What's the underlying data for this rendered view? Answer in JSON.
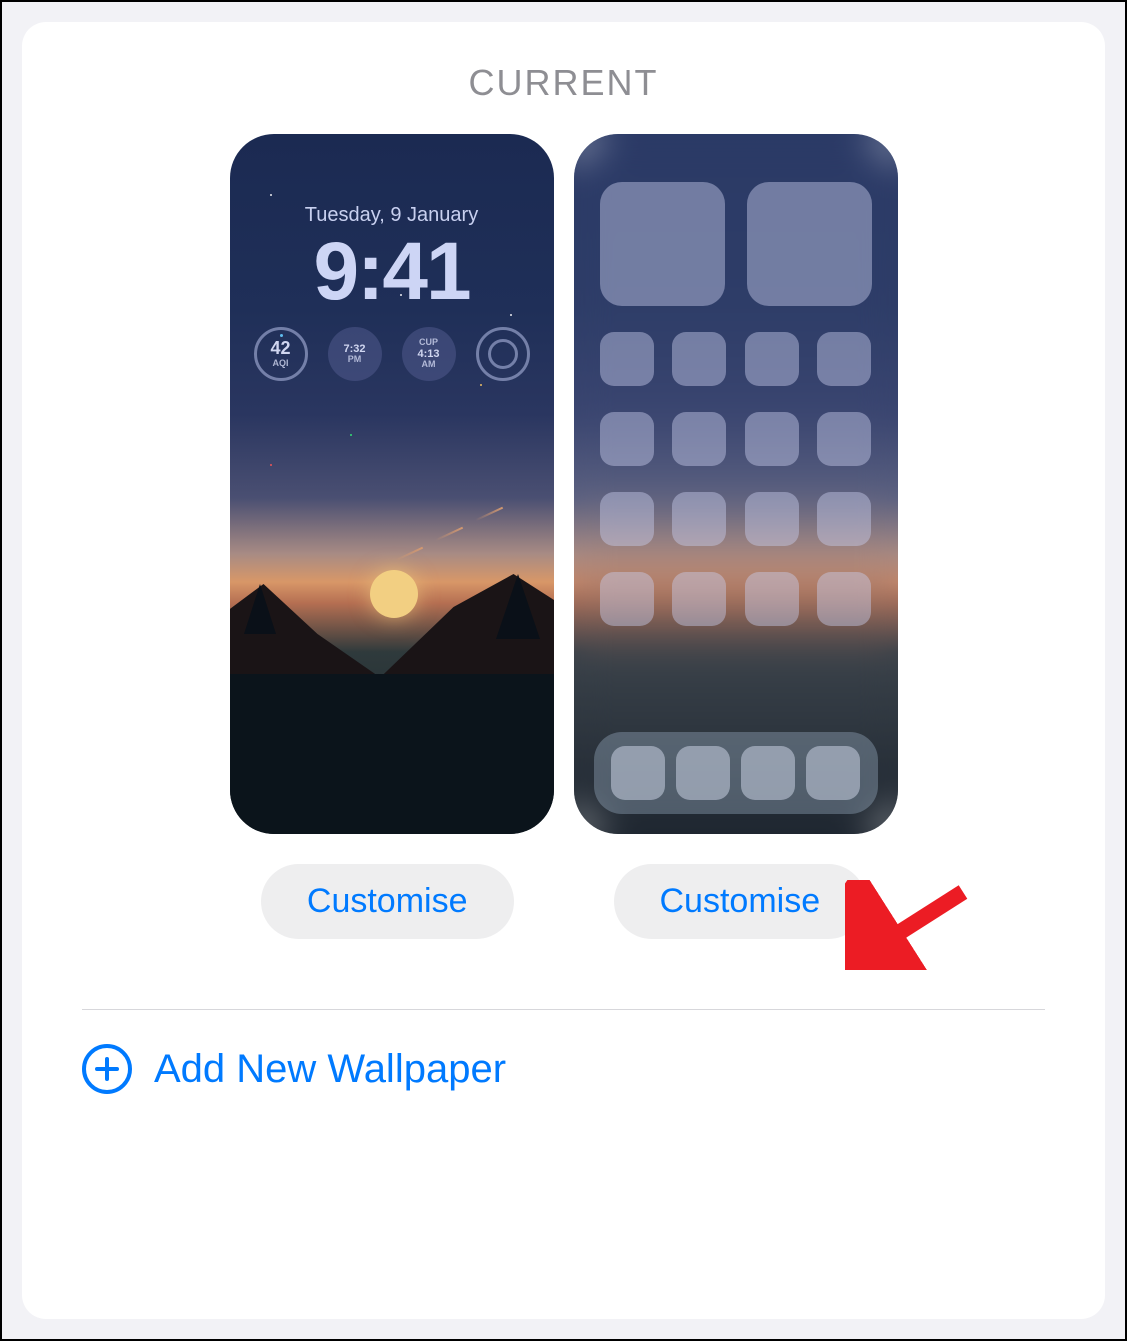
{
  "section_title": "CURRENT",
  "lock_screen": {
    "date": "Tuesday, 9 January",
    "time": "9:41",
    "widgets": {
      "aqi": {
        "value": "42",
        "label": "AQI"
      },
      "clock1": {
        "time": "7:32",
        "period": "PM"
      },
      "clock2": {
        "label": "CUP",
        "time": "4:13",
        "period": "AM"
      }
    }
  },
  "buttons": {
    "customise_lock": "Customise",
    "customise_home": "Customise"
  },
  "add_new": "Add New Wallpaper"
}
